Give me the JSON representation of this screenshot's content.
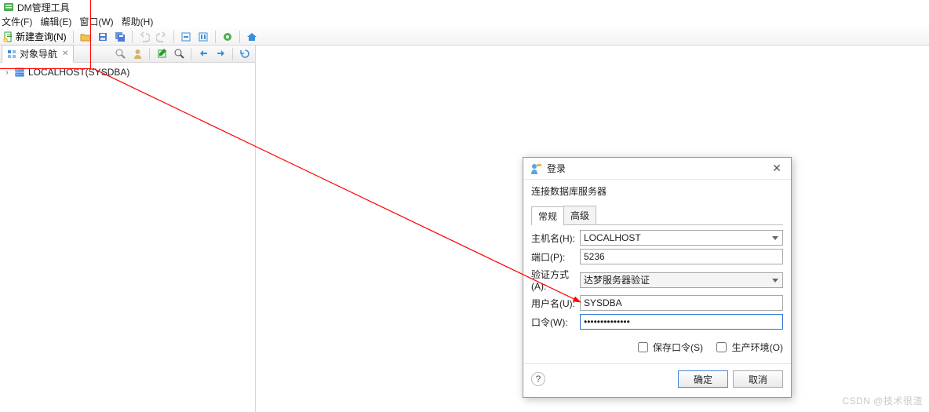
{
  "window": {
    "title": "DM管理工具"
  },
  "menu": {
    "file": "文件(F)",
    "edit": "编辑(E)",
    "window": "窗口(W)",
    "help": "帮助(H)"
  },
  "toolbar": {
    "newQuery": "新建查询(N)"
  },
  "objectNav": {
    "tabLabel": "对象导航",
    "node": "LOCALHOST(SYSDBA)"
  },
  "dialog": {
    "title": "登录",
    "subtitle": "连接数据库服务器",
    "tabs": {
      "general": "常规",
      "advanced": "高级"
    },
    "labels": {
      "host": "主机名(H):",
      "port": "端口(P):",
      "auth": "验证方式(A):",
      "user": "用户名(U):",
      "pwd": "口令(W):"
    },
    "values": {
      "host": "LOCALHOST",
      "port": "5236",
      "auth": "达梦服务器验证",
      "user": "SYSDBA",
      "pwd": "••••••••••••••"
    },
    "savePwd": "保存口令(S)",
    "prod": "生产环境(O)",
    "ok": "确定",
    "cancel": "取消",
    "help": "?"
  },
  "watermark": "CSDN @技术很渣"
}
